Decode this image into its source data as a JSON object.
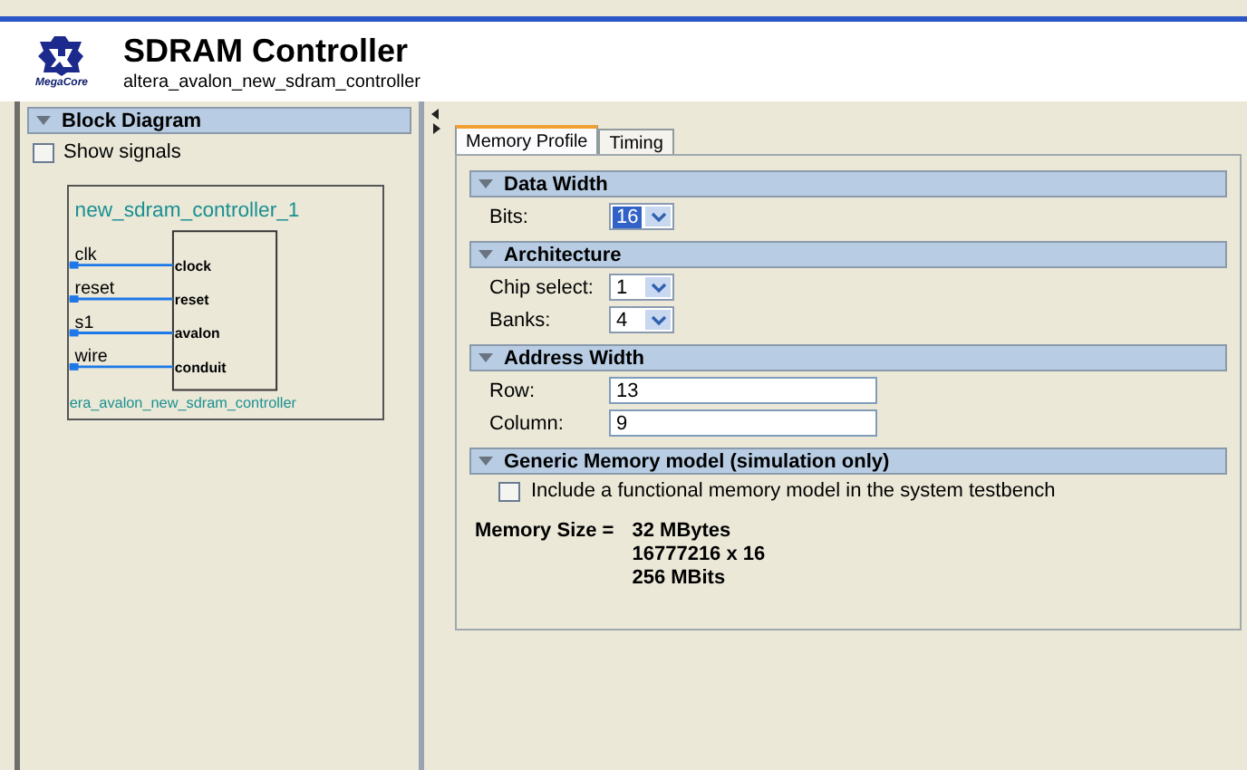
{
  "header": {
    "logo_text": "MegaCore",
    "title": "SDRAM Controller",
    "subtitle": "altera_avalon_new_sdram_controller"
  },
  "left_panel": {
    "title": "Block Diagram",
    "expanded": true,
    "show_signals": {
      "label": "Show signals",
      "checked": false
    },
    "component": {
      "instance": "new_sdram_controller_1",
      "type_name": "era_avalon_new_sdram_controller",
      "ports": [
        {
          "signal": "clk",
          "port": "clock"
        },
        {
          "signal": "reset",
          "port": "reset"
        },
        {
          "signal": "s1",
          "port": "avalon"
        },
        {
          "signal": "wire",
          "port": "conduit"
        }
      ]
    }
  },
  "tabs": [
    {
      "label": "Memory Profile",
      "selected": true
    },
    {
      "label": "Timing",
      "selected": false
    }
  ],
  "sections": [
    {
      "title": "Data Width",
      "expanded": true,
      "fields": [
        {
          "kind": "dropdown",
          "label": "Bits:",
          "value": "16",
          "focused": true
        }
      ]
    },
    {
      "title": "Architecture",
      "expanded": true,
      "fields": [
        {
          "kind": "dropdown",
          "label": "Chip select:",
          "value": "1",
          "focused": false
        },
        {
          "kind": "dropdown",
          "label": "Banks:",
          "value": "4",
          "focused": false
        }
      ]
    },
    {
      "title": "Address Width",
      "expanded": true,
      "fields": [
        {
          "kind": "text",
          "label": "Row:",
          "value": "13"
        },
        {
          "kind": "text",
          "label": "Column:",
          "value": "9"
        }
      ]
    },
    {
      "title": "Generic Memory model (simulation only)",
      "expanded": true,
      "fields": [
        {
          "kind": "checkbox",
          "label": "Include a functional memory model in the system testbench",
          "checked": false
        }
      ]
    }
  ],
  "memory_size": {
    "label": "Memory Size =",
    "lines": [
      "32 MBytes",
      "16777216 x 16",
      "256 MBits"
    ]
  }
}
